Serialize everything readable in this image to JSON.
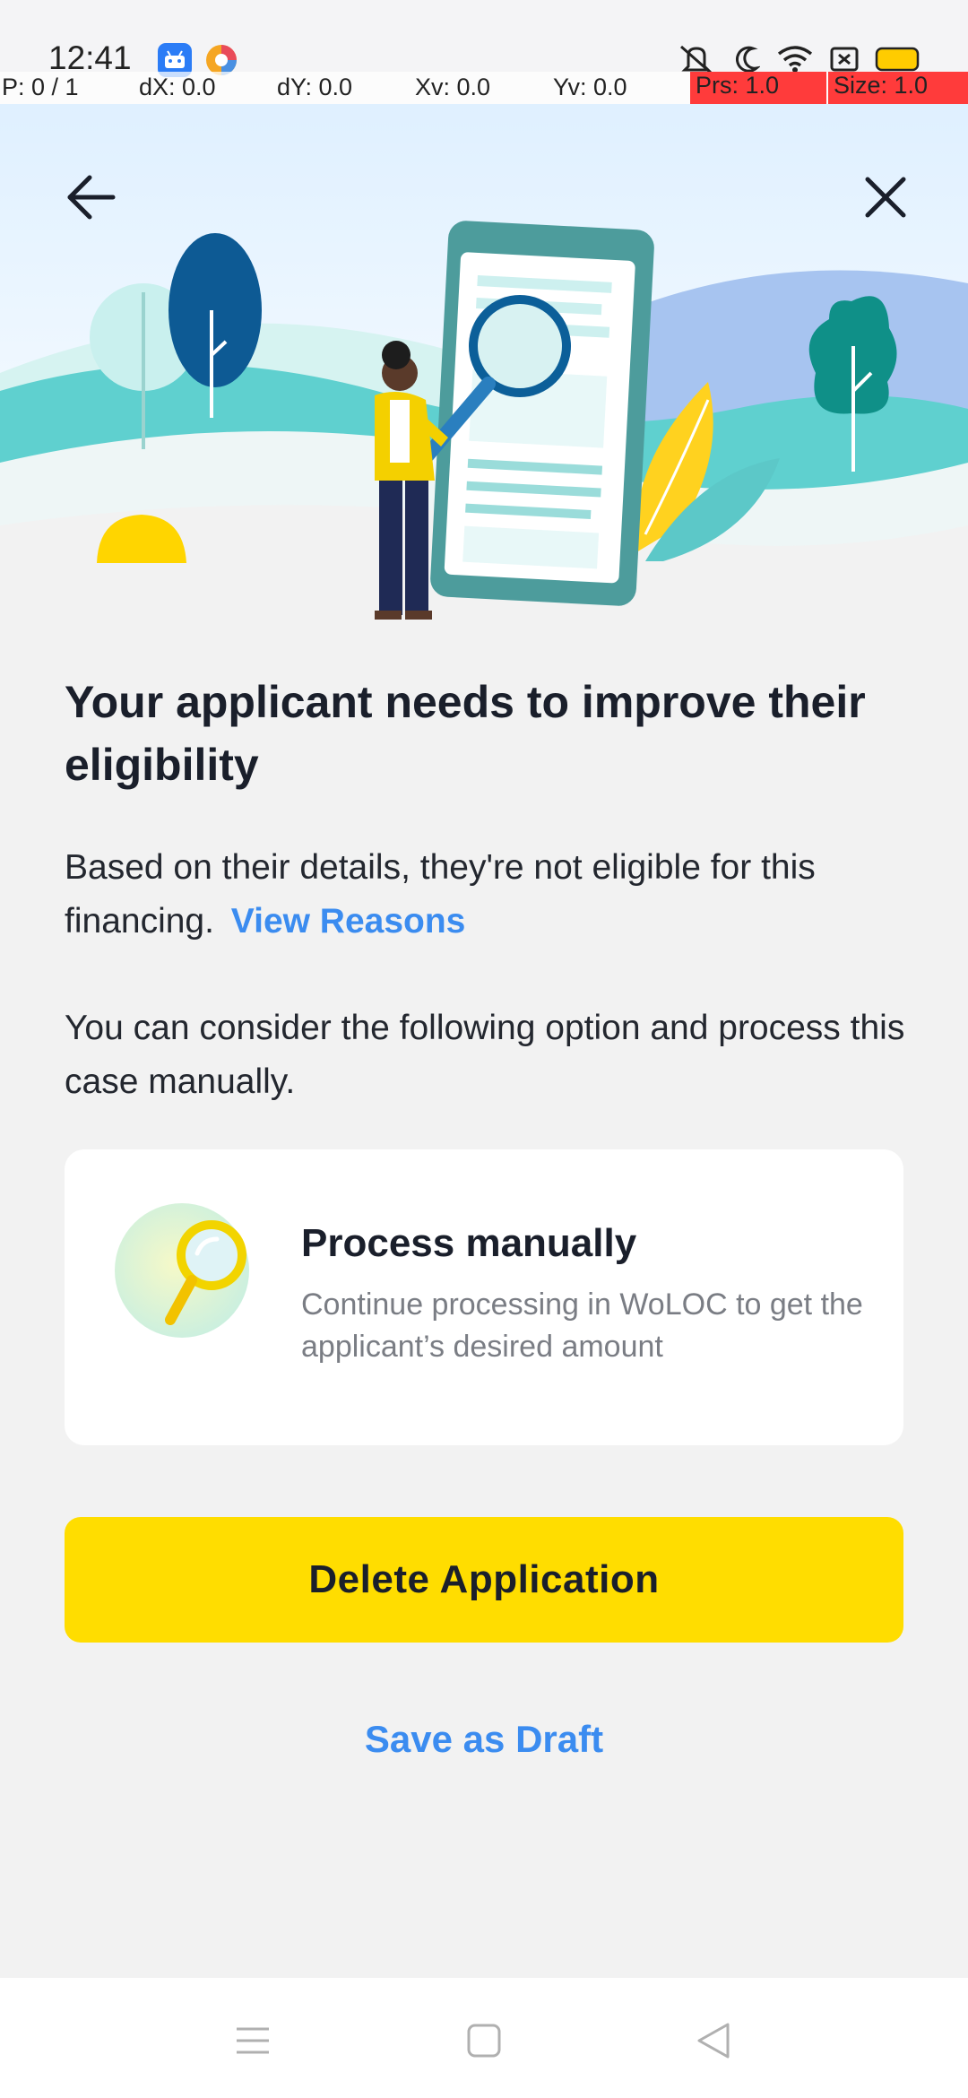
{
  "status_bar": {
    "time": "12:41",
    "icons": [
      "android-app-icon",
      "colorful-app-icon",
      "mute-icon",
      "moon-icon",
      "wifi-icon",
      "sim-icon",
      "battery-icon"
    ]
  },
  "debug": {
    "pointer": "P: 0 / 1",
    "dx": "dX: 0.0",
    "dy": "dY: 0.0",
    "xv": "Xv: 0.0",
    "yv": "Yv: 0.0",
    "prs": "Prs: 1.0",
    "size": "Size: 1.0"
  },
  "header": {
    "back_icon": "arrow-left-icon",
    "close_icon": "close-icon"
  },
  "main": {
    "title": "Your applicant needs to improve their eligibility",
    "paragraph1": "Based on their details, they're not eligible for this financing.",
    "view_reasons_link": "View Reasons",
    "paragraph2": "You can consider the following option and process this case manually."
  },
  "option_card": {
    "icon": "magnifier-icon",
    "title": "Process manually",
    "description": "Continue processing in WoLOC to get the applicant’s desired amount"
  },
  "actions": {
    "delete_label": "Delete Application",
    "save_draft_label": "Save as Draft"
  },
  "colors": {
    "accent_yellow": "#ffdd00",
    "link_blue": "#3b8cf0",
    "background": "#f2f2f2"
  }
}
